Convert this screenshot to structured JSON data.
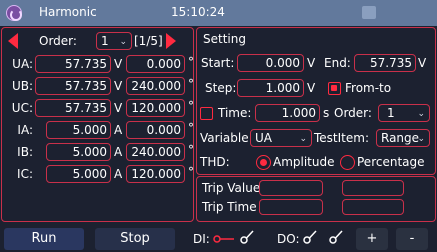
{
  "titlebar": {
    "title": "Harmonic",
    "time": "15:10:24"
  },
  "order_nav": {
    "label": "Order:",
    "value": "1",
    "pages": "[1/5]"
  },
  "channels": [
    {
      "label": "UA:",
      "magnitude": "57.735",
      "unit": "V",
      "angle": "0.000",
      "angle_unit": "°"
    },
    {
      "label": "UB:",
      "magnitude": "57.735",
      "unit": "V",
      "angle": "240.000",
      "angle_unit": "°"
    },
    {
      "label": "UC:",
      "magnitude": "57.735",
      "unit": "V",
      "angle": "120.000",
      "angle_unit": "°"
    },
    {
      "label": "IA:",
      "magnitude": "5.000",
      "unit": "A",
      "angle": "0.000",
      "angle_unit": "°"
    },
    {
      "label": "IB:",
      "magnitude": "5.000",
      "unit": "A",
      "angle": "240.000",
      "angle_unit": "°"
    },
    {
      "label": "IC:",
      "magnitude": "5.000",
      "unit": "A",
      "angle": "120.000",
      "angle_unit": "°"
    }
  ],
  "setting": {
    "header": "Setting",
    "start_label": "Start:",
    "start_value": "0.000",
    "start_unit": "V",
    "end_label": "End:",
    "end_value": "57.735",
    "end_unit": "V",
    "step_label": "Step:",
    "step_value": "1.000",
    "step_unit": "V",
    "fromto_label": "From-to",
    "fromto_checked": true,
    "time_label": "Time:",
    "time_value": "1.000",
    "time_unit": "s",
    "time_checked": false,
    "order_label": "Order:",
    "order_value": "1",
    "variable_label": "Variable:",
    "variable_value": "UA",
    "testitem_label": "TestItem:",
    "testitem_value": "Range",
    "thd_label": "THD:",
    "amplitude_label": "Amplitude",
    "amplitude_selected": true,
    "percentage_label": "Percentage",
    "percentage_selected": false
  },
  "trip": {
    "value_label": "Trip Value",
    "time_label": "Trip Time",
    "value_1": "",
    "value_2": "",
    "time_1": "",
    "time_2": ""
  },
  "bottom": {
    "run_label": "Run",
    "stop_label": "Stop",
    "di_label": "DI:",
    "do_label": "DO:",
    "plus_label": "+",
    "minus_label": "-"
  },
  "colors": {
    "accent": "#ff2a40",
    "border": "#c9304a",
    "background": "#1c2130",
    "titlebar": "#62799c"
  }
}
